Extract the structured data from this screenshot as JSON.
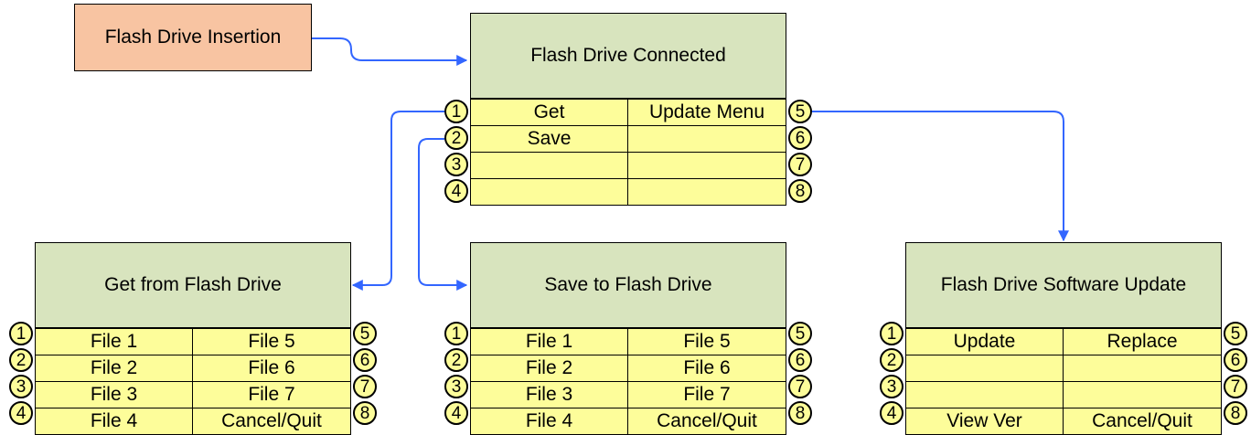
{
  "colors": {
    "trigger_fill": "#f8c4a2",
    "title_fill": "#d8e4be",
    "option_fill": "#fdfd9a",
    "connector": "#3366ff"
  },
  "trigger": {
    "label": "Flash Drive Insertion"
  },
  "menus": {
    "connected": {
      "title": "Flash Drive Connected",
      "left_numbers": [
        "1",
        "2",
        "3",
        "4"
      ],
      "right_numbers": [
        "5",
        "6",
        "7",
        "8"
      ],
      "left": [
        "Get",
        "Save",
        "",
        ""
      ],
      "right": [
        "Update Menu",
        "",
        "",
        ""
      ]
    },
    "get": {
      "title": "Get from Flash Drive",
      "left_numbers": [
        "1",
        "2",
        "3",
        "4"
      ],
      "right_numbers": [
        "5",
        "6",
        "7",
        "8"
      ],
      "left": [
        "File 1",
        "File 2",
        "File 3",
        "File 4"
      ],
      "right": [
        "File 5",
        "File 6",
        "File 7",
        "Cancel/Quit"
      ]
    },
    "save": {
      "title": "Save to Flash Drive",
      "left_numbers": [
        "1",
        "2",
        "3",
        "4"
      ],
      "right_numbers": [
        "5",
        "6",
        "7",
        "8"
      ],
      "left": [
        "File 1",
        "File 2",
        "File 3",
        "File 4"
      ],
      "right": [
        "File 5",
        "File 6",
        "File 7",
        "Cancel/Quit"
      ]
    },
    "update": {
      "title": "Flash Drive Software Update",
      "left_numbers": [
        "1",
        "2",
        "3",
        "4"
      ],
      "right_numbers": [
        "5",
        "6",
        "7",
        "8"
      ],
      "left": [
        "Update",
        "",
        "",
        "View Ver"
      ],
      "right": [
        "Replace",
        "",
        "",
        "Cancel/Quit"
      ]
    }
  }
}
